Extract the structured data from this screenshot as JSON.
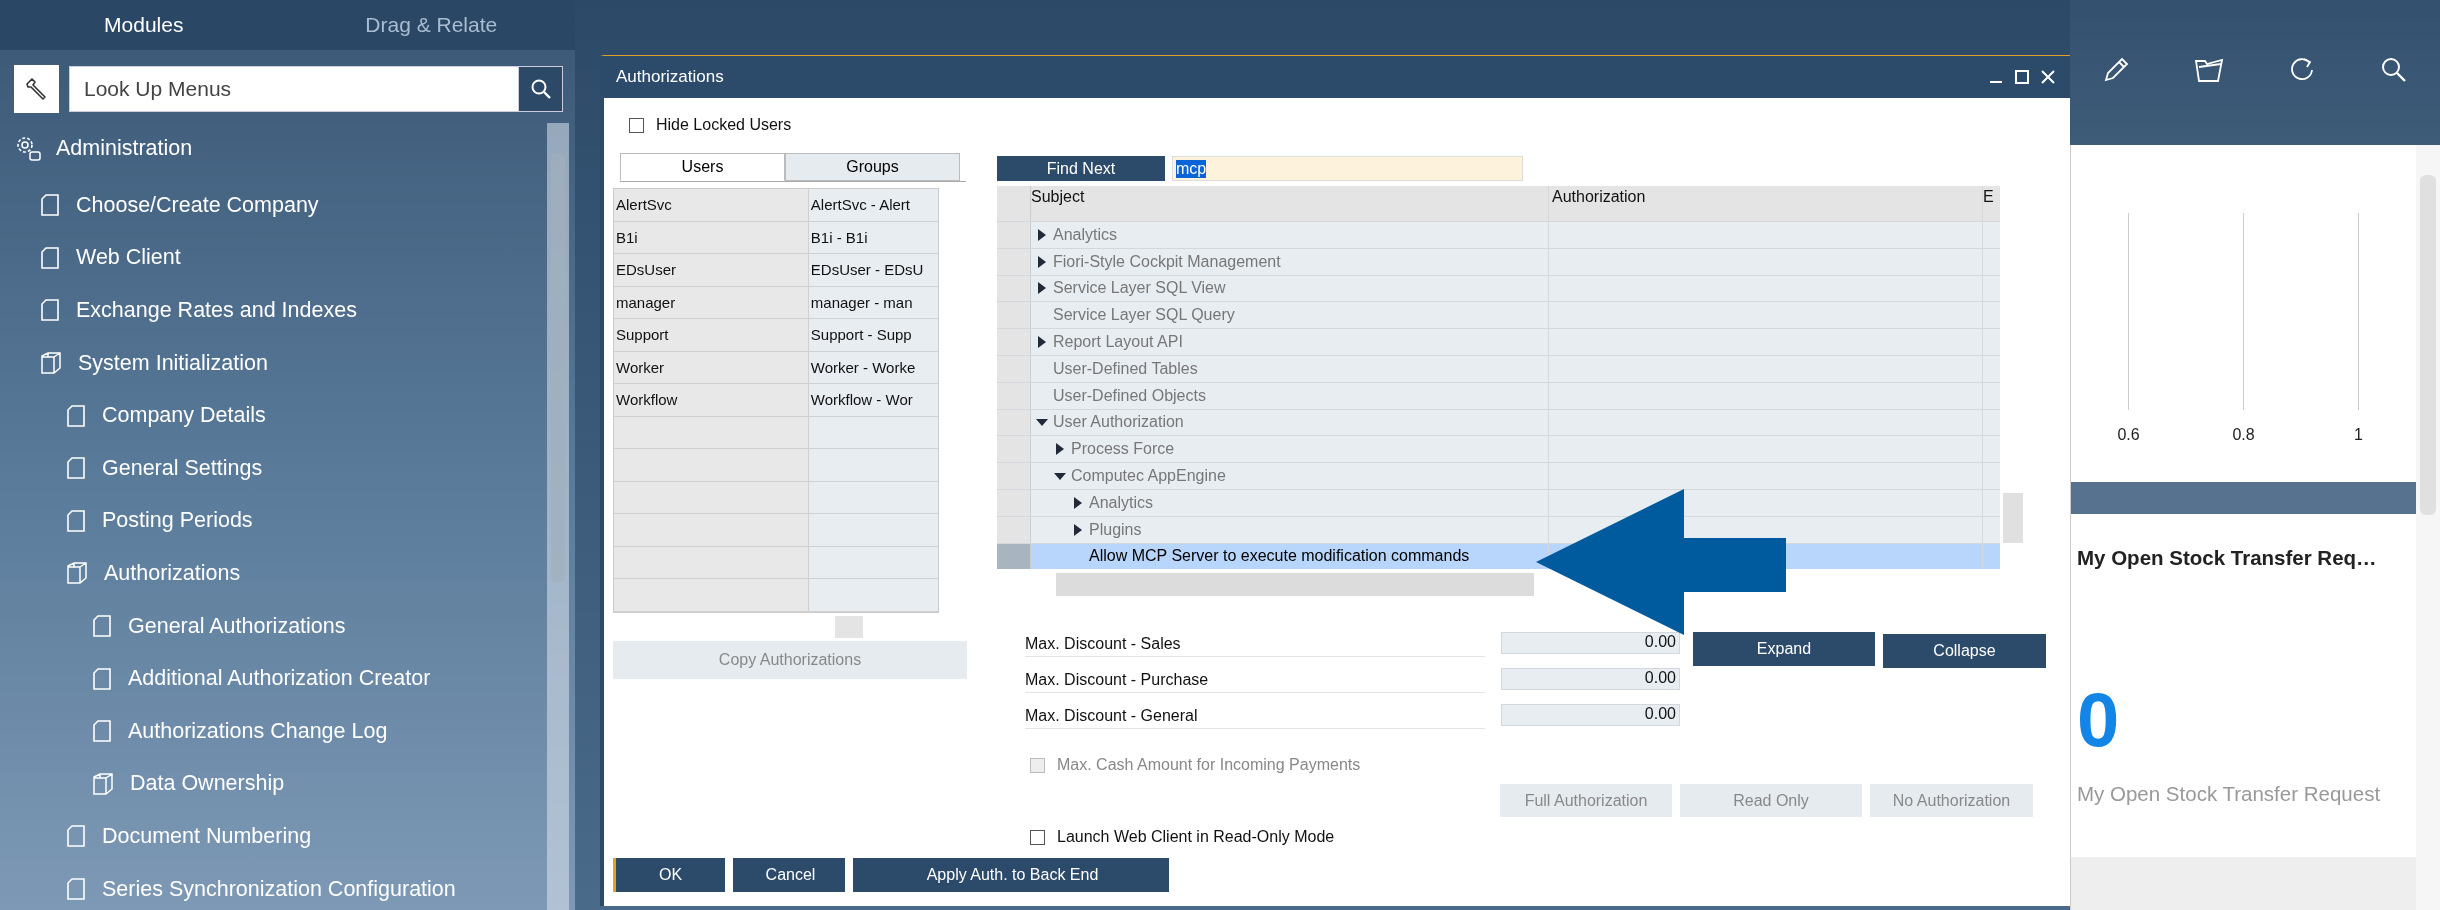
{
  "sidebar": {
    "tabs": [
      {
        "label": "Modules",
        "selected": true
      },
      {
        "label": "Drag & Relate",
        "selected": false
      }
    ],
    "search": {
      "placeholder": "Look Up Menus"
    },
    "tree": [
      {
        "label": "Administration",
        "kind": "module",
        "children": [
          {
            "label": "Choose/Create Company",
            "kind": "page"
          },
          {
            "label": "Web Client",
            "kind": "page"
          },
          {
            "label": "Exchange Rates and Indexes",
            "kind": "page"
          },
          {
            "label": "System Initialization",
            "kind": "folder",
            "children": [
              {
                "label": "Company Details",
                "kind": "page"
              },
              {
                "label": "General Settings",
                "kind": "page"
              },
              {
                "label": "Posting Periods",
                "kind": "page"
              },
              {
                "label": "Authorizations",
                "kind": "folder",
                "children": [
                  {
                    "label": "General Authorizations",
                    "kind": "page"
                  },
                  {
                    "label": "Additional Authorization Creator",
                    "kind": "page"
                  },
                  {
                    "label": "Authorizations Change Log",
                    "kind": "page"
                  },
                  {
                    "label": "Data Ownership",
                    "kind": "folder"
                  }
                ]
              },
              {
                "label": "Document Numbering",
                "kind": "page"
              },
              {
                "label": "Series Synchronization Configuration",
                "kind": "page"
              }
            ]
          }
        ]
      }
    ]
  },
  "dialog": {
    "title": "Authorizations",
    "hide_locked_users": {
      "label": "Hide Locked Users",
      "checked": false
    },
    "tabs": [
      {
        "label": "Users",
        "selected": true
      },
      {
        "label": "Groups",
        "selected": false
      }
    ],
    "users": [
      {
        "code": "AlertSvc",
        "name": "AlertSvc - Alert"
      },
      {
        "code": "B1i",
        "name": "B1i - B1i"
      },
      {
        "code": "EDsUser",
        "name": "EDsUser - EDsU"
      },
      {
        "code": "manager",
        "name": "manager - man"
      },
      {
        "code": "Support",
        "name": "Support - Supp"
      },
      {
        "code": "Worker",
        "name": "Worker - Worke"
      },
      {
        "code": "Workflow",
        "name": "Workflow - Wor"
      }
    ],
    "copy_button": {
      "label": "Copy Authorizations",
      "disabled": true
    },
    "find_button": "Find Next",
    "find_field": {
      "value": "mcp"
    },
    "columns": [
      "Subject",
      "Authorization",
      "E"
    ],
    "tree": [
      {
        "label": "Analytics",
        "kind": "branch",
        "expanded": false,
        "selected": false
      },
      {
        "label": "Fiori-Style Cockpit Management",
        "kind": "branch",
        "expanded": false,
        "selected": false
      },
      {
        "label": "Service Layer SQL View",
        "kind": "branch",
        "expanded": false,
        "selected": false
      },
      {
        "label": "Service Layer SQL Query",
        "kind": "leaf",
        "selected": false
      },
      {
        "label": "Report Layout API",
        "kind": "branch",
        "expanded": false,
        "selected": false
      },
      {
        "label": "User-Defined Tables",
        "kind": "leaf",
        "selected": false
      },
      {
        "label": "User-Defined Objects",
        "kind": "leaf",
        "selected": false
      },
      {
        "label": "User Authorization",
        "kind": "branch",
        "expanded": true,
        "selected": false,
        "children": [
          {
            "label": "Process Force",
            "kind": "branch",
            "expanded": false,
            "selected": false
          },
          {
            "label": "Computec AppEngine",
            "kind": "branch",
            "expanded": true,
            "selected": false,
            "children": [
              {
                "label": "Analytics",
                "kind": "branch",
                "expanded": false,
                "selected": false
              },
              {
                "label": "Plugins",
                "kind": "branch",
                "expanded": false,
                "selected": false
              },
              {
                "label": "Allow MCP Server to execute modification commands",
                "kind": "leaf",
                "selected": true
              }
            ]
          }
        ]
      }
    ],
    "discounts": [
      {
        "label": "Max. Discount - Sales",
        "value": "0.00"
      },
      {
        "label": "Max. Discount - Purchase",
        "value": "0.00"
      },
      {
        "label": "Max. Discount - General",
        "value": "0.00"
      }
    ],
    "tree_buttons": [
      {
        "label": "Expand",
        "disabled": false
      },
      {
        "label": "Collapse",
        "disabled": false
      }
    ],
    "max_cash": {
      "label": "Max. Cash Amount for Incoming Payments",
      "checked": false,
      "disabled": true
    },
    "auth_buttons": [
      {
        "label": "Full Authorization",
        "disabled": true
      },
      {
        "label": "Read Only",
        "disabled": true
      },
      {
        "label": "No Authorization",
        "disabled": true
      }
    ],
    "launch_web_client": {
      "label": "Launch Web Client in Read-Only Mode",
      "checked": false
    },
    "footer_buttons": [
      {
        "label": "OK",
        "default": true
      },
      {
        "label": "Cancel",
        "default": false
      },
      {
        "label": "Apply Auth. to Back End",
        "default": false
      }
    ]
  },
  "cockpit": {
    "axis_labels": [
      "0.6",
      "0.8",
      "1"
    ],
    "card": {
      "title": "My Open Stock Transfer Req…",
      "value": "0",
      "caption": "My Open Stock Transfer Request"
    }
  }
}
